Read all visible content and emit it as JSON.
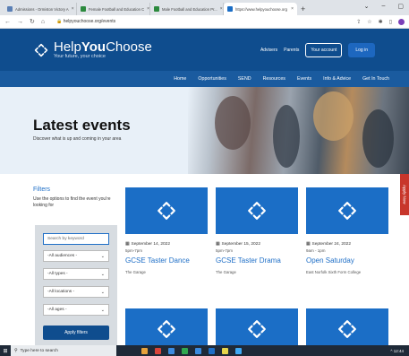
{
  "browser": {
    "tabs": [
      {
        "label": "Admissions - Ormiston Victory A",
        "color": "#5a7fb5",
        "active": false
      },
      {
        "label": "Female Football and Education C",
        "color": "#2c8a3e",
        "active": false
      },
      {
        "label": "Male Football and Education Pr...",
        "color": "#2c8a3e",
        "active": false
      },
      {
        "label": "https://www.helpyouchoose.org",
        "color": "#1b6ec6",
        "active": true
      }
    ],
    "url": "helpyouchoose.org/events"
  },
  "header": {
    "brand_light": "Help",
    "brand_bold": "You",
    "brand_end": "Choose",
    "tagline": "Your future, your choice",
    "links": [
      "Advisers",
      "Parents"
    ],
    "account_label": "Your account",
    "login_label": "Log in"
  },
  "nav": [
    "Home",
    "Opportunities",
    "SEND",
    "Resources",
    "Events",
    "Info & Advice",
    "Get In Touch"
  ],
  "hero": {
    "title": "Latest events",
    "subtitle": "Discover what is up and coming in your area"
  },
  "apply_now": "Apply Now",
  "filters": {
    "heading": "Filters",
    "description": "Use the options to find the event you're looking for",
    "search_placeholder": "Search by keyword",
    "selects": [
      "-All audiences -",
      "-All types -",
      "-All locations -",
      "-All ages -"
    ],
    "apply_label": "Apply filters"
  },
  "events": [
    {
      "date": "September 14, 2022",
      "time": "5pm-7pm",
      "title": "GCSE Taster Dance",
      "location": "The Garage"
    },
    {
      "date": "September 15, 2022",
      "time": "5pm-7pm",
      "title": "GCSE Taster Drama",
      "location": "The Garage"
    },
    {
      "date": "September 24, 2022",
      "time": "9am - 1pm",
      "title": "Open Saturday",
      "location": "East Norfolk Sixth Form College"
    }
  ],
  "taskbar": {
    "search_placeholder": "Type here to search",
    "app_colors": [
      "#e6a23c",
      "#d9453b",
      "#3b8be0",
      "#2fa84f",
      "#3b8be0",
      "#1e6fc7",
      "#e6d54a",
      "#3fa9f5"
    ],
    "tray": "^ 12:44"
  }
}
